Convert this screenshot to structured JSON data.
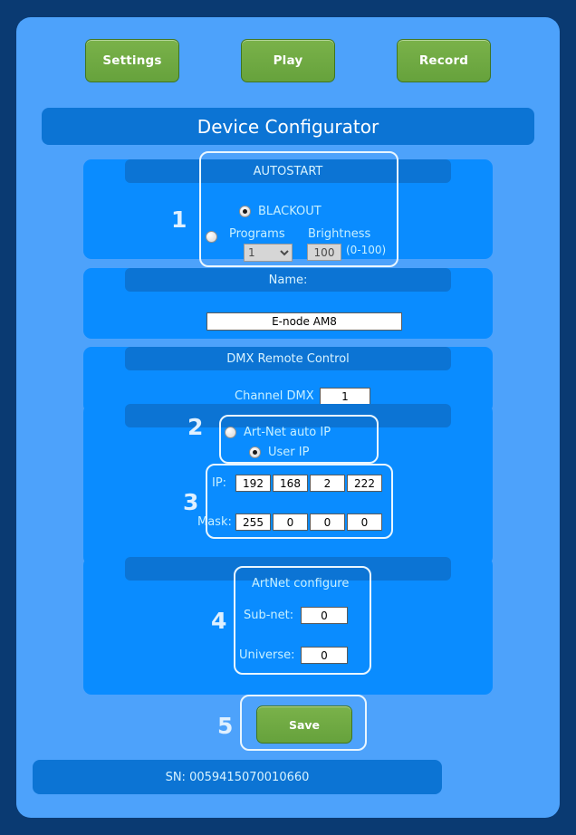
{
  "window": {
    "title": "Device Configurator"
  },
  "toolbar": {
    "buttons": [
      {
        "label": "Settings",
        "name": "settings-button"
      },
      {
        "label": "Play",
        "name": "play-button"
      },
      {
        "label": "Record",
        "name": "record-button"
      }
    ]
  },
  "autostart": {
    "callout": "1",
    "header": "AUTOSTART",
    "blackout_label": "BLACKOUT",
    "blackout_selected": true,
    "programs_label": "Programs",
    "brightness_label": "Brightness",
    "programs_selected": false,
    "programs_value": "1",
    "programs_options": [
      "1"
    ],
    "brightness_value": "100",
    "brightness_range": "(0-100)"
  },
  "name_section": {
    "header": "Name:",
    "value": "E-node AM8"
  },
  "dmx_section": {
    "header": "DMX Remote Control",
    "channel_label": "Channel DMX",
    "channel_value": "1"
  },
  "ip_mode": {
    "callout": "2",
    "auto_label": "Art-Net auto IP",
    "auto_selected": false,
    "user_label": "User IP",
    "user_selected": true
  },
  "ip_config": {
    "callout": "3",
    "ip_label": "IP:",
    "ip_octets": [
      "192",
      "168",
      "2",
      "222"
    ],
    "mask_label": "Mask:",
    "mask_octets": [
      "255",
      "0",
      "0",
      "0"
    ]
  },
  "artnet": {
    "callout": "4",
    "header": "ArtNet configure",
    "subnet_label": "Sub-net:",
    "subnet_value": "0",
    "universe_label": "Universe:",
    "universe_value": "0"
  },
  "save": {
    "callout": "5",
    "label": "Save"
  },
  "footer": {
    "serial": "SN: 0059415070010660"
  },
  "colors": {
    "outer_bg": "#0a3a72",
    "panel_bg": "#4da2fb",
    "section_bg": "#0a8cff",
    "header_bg": "#0c74d4",
    "accent_green": "#6fa845",
    "outline": "#e9f6ff",
    "label_text": "#c8f0ff"
  }
}
